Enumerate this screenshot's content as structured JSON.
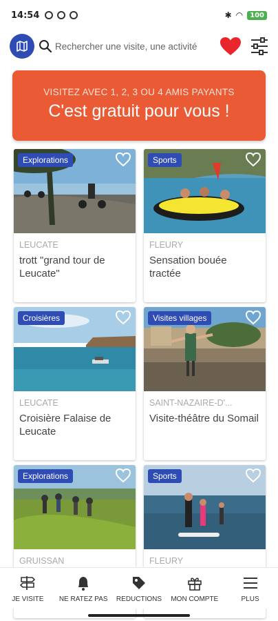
{
  "status_bar": {
    "time": "14:54",
    "battery": "100"
  },
  "header": {
    "search_placeholder": "Rechercher une visite, une activité",
    "icons": [
      "map-icon",
      "search-icon",
      "heart-icon",
      "filter-icon"
    ]
  },
  "banner": {
    "line1": "VISITEZ AVEC 1, 2, 3 OU 4 AMIS PAYANTS",
    "line2": "C'est gratuit pour vous !",
    "color": "#ea5a34"
  },
  "cards": [
    {
      "badge": "Explorations",
      "place": "LEUCATE",
      "title": "trott \"grand tour de Leucate\""
    },
    {
      "badge": "Sports",
      "place": "FLEURY",
      "title": "Sensation bouée tractée"
    },
    {
      "badge": "Croisières",
      "place": "LEUCATE",
      "title": "Croisière Falaise de Leucate"
    },
    {
      "badge": "Visites villages",
      "place": "SAINT-NAZAIRE-D'...",
      "title": "Visite-théâtre du Somail"
    },
    {
      "badge": "Explorations",
      "place": "GRUISSAN",
      "title": ""
    },
    {
      "badge": "Sports",
      "place": "FLEURY",
      "title": ""
    }
  ],
  "bottom_nav": [
    {
      "label": "JE VISITE",
      "icon": "signpost-icon"
    },
    {
      "label": "NE RATEZ PAS",
      "icon": "bell-icon"
    },
    {
      "label": "REDUCTIONS",
      "icon": "tag-icon"
    },
    {
      "label": "MON COMPTE",
      "icon": "gift-icon"
    },
    {
      "label": "PLUS",
      "icon": "menu-icon"
    }
  ],
  "colors": {
    "accent_blue": "#2f4cb5",
    "heart_red": "#e8262b",
    "banner": "#ea5a34"
  }
}
